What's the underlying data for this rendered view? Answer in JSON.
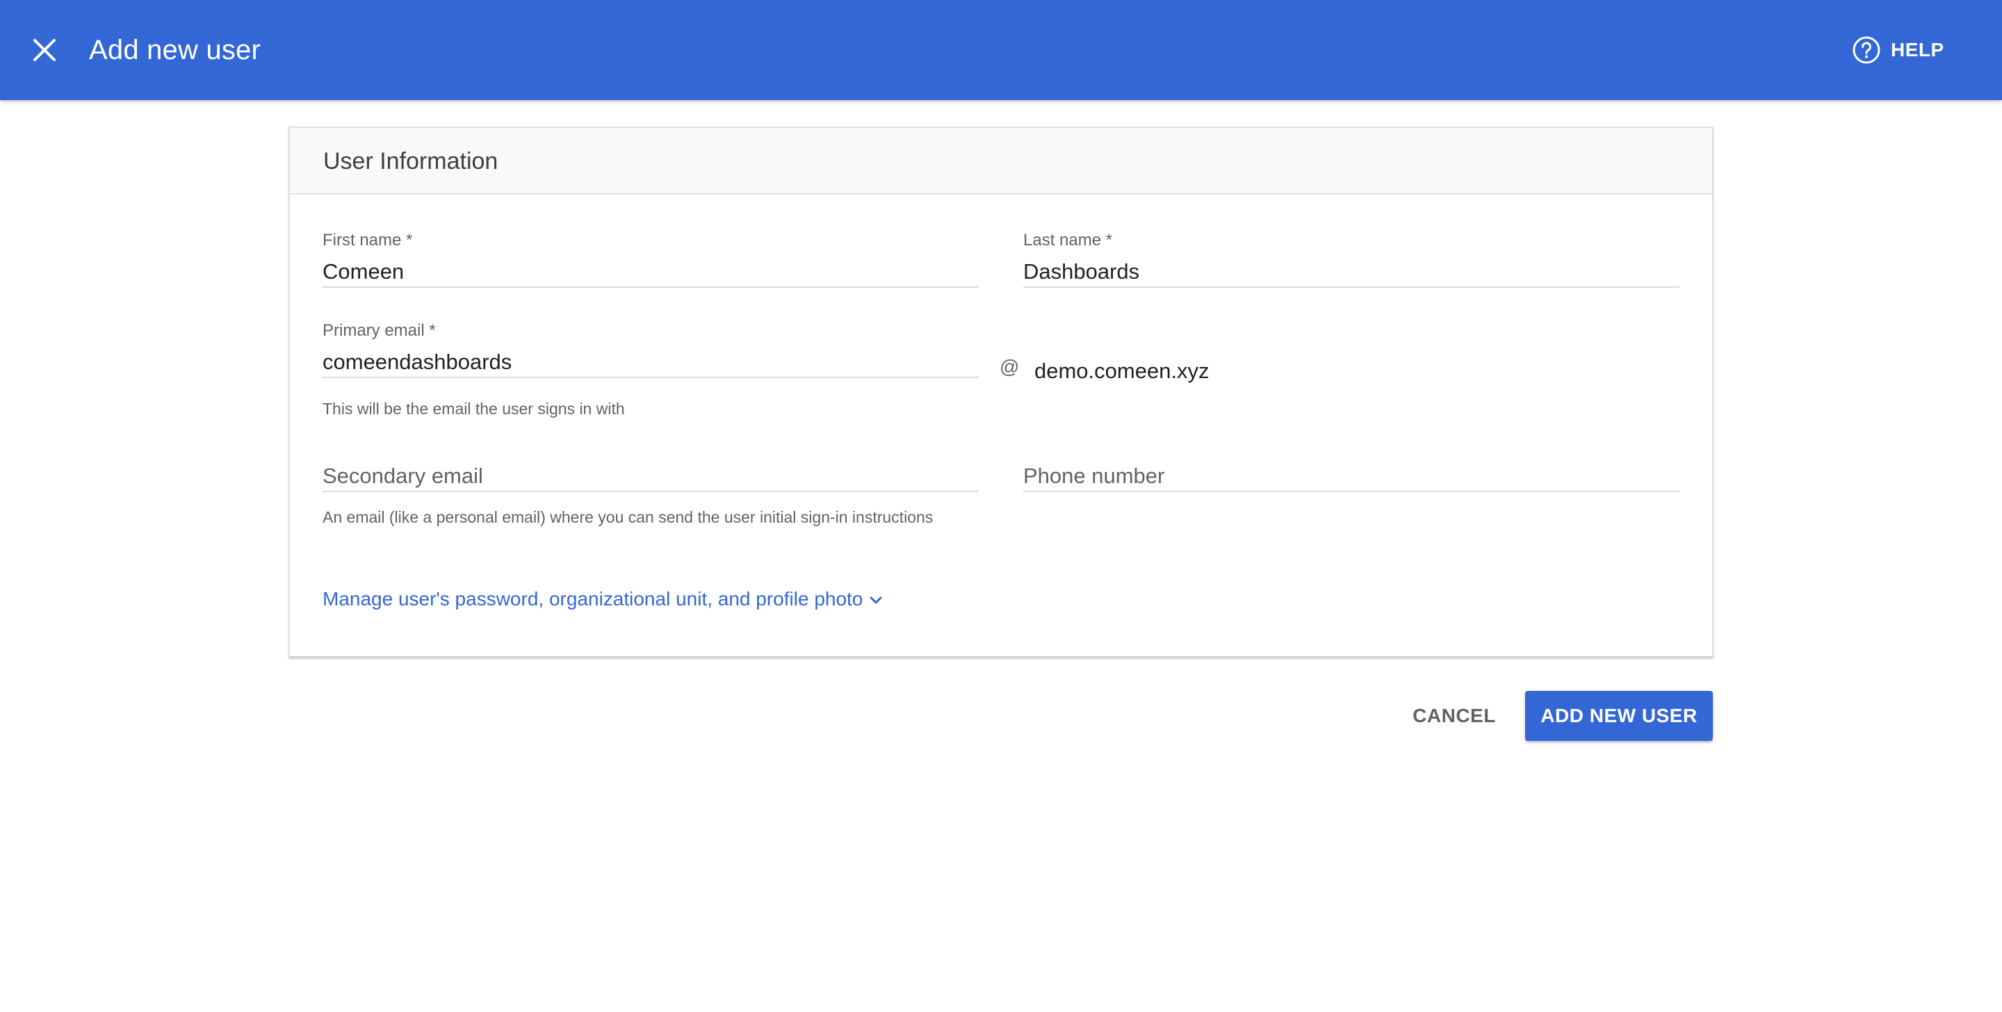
{
  "header": {
    "title": "Add new user",
    "help_label": "HELP",
    "background": "#3367d6"
  },
  "card": {
    "title": "User Information",
    "first_name": {
      "label": "First name *",
      "value": "Comeen"
    },
    "last_name": {
      "label": "Last name *",
      "value": "Dashboards"
    },
    "primary_email": {
      "label": "Primary email *",
      "value": "comeendashboards",
      "at": "@",
      "domain": "demo.comeen.xyz",
      "helper": "This will be the email the user signs in with"
    },
    "secondary_email": {
      "placeholder": "Secondary email",
      "helper": "An email (like a personal email) where you can send the user initial sign-in instructions"
    },
    "phone": {
      "placeholder": "Phone number"
    },
    "manage_link": "Manage user's password, organizational unit, and profile photo"
  },
  "actions": {
    "cancel_label": "CANCEL",
    "add_label": "ADD NEW USER"
  },
  "icons": {
    "close": "close-icon",
    "help": "help-circle-icon",
    "chevron": "chevron-down-icon"
  }
}
